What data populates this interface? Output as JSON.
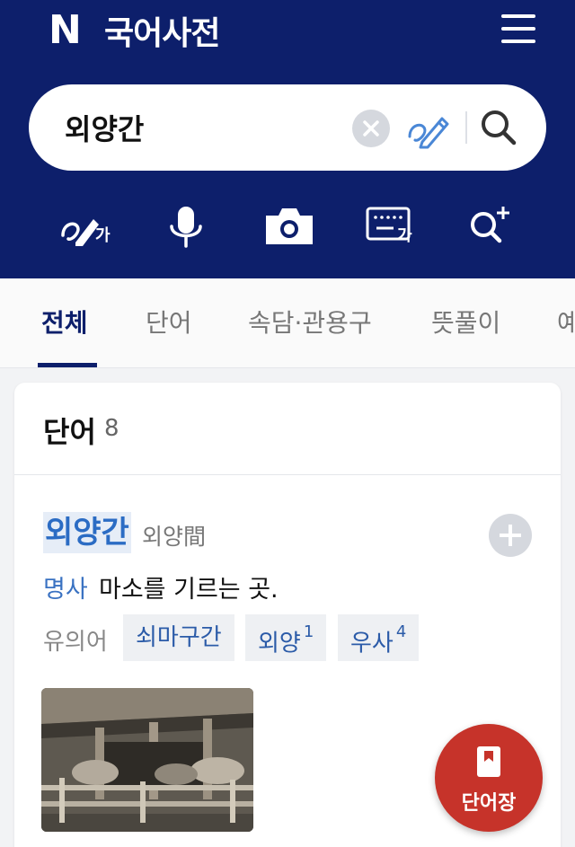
{
  "header": {
    "logo": "N",
    "title": "국어사전"
  },
  "search": {
    "value": "외양간"
  },
  "tools": [
    {
      "name": "handwriting-input-icon",
      "label": "가"
    },
    {
      "name": "voice-search-icon",
      "label": ""
    },
    {
      "name": "camera-search-icon",
      "label": ""
    },
    {
      "name": "keyboard-input-icon",
      "label": "가"
    },
    {
      "name": "advanced-search-icon",
      "label": ""
    }
  ],
  "tabs": [
    {
      "label": "전체",
      "active": true
    },
    {
      "label": "단어",
      "active": false
    },
    {
      "label": "속담·관용구",
      "active": false
    },
    {
      "label": "뜻풀이",
      "active": false
    },
    {
      "label": "예",
      "active": false
    }
  ],
  "results": {
    "section_title": "단어",
    "count": "8",
    "entry": {
      "word": "외양간",
      "hanja": "외양間",
      "pos": "명사",
      "definition": "마소를 기르는 곳.",
      "synonym_label": "유의어",
      "synonyms": [
        {
          "text": "쇠마구간",
          "sup": ""
        },
        {
          "text": "외양",
          "sup": "1"
        },
        {
          "text": "우사",
          "sup": "4"
        }
      ]
    }
  },
  "fab": {
    "label": "단어장"
  },
  "colors": {
    "header_bg": "#0d1f6b",
    "accent_blue": "#2b6cc4",
    "fab_red": "#c6332a"
  }
}
